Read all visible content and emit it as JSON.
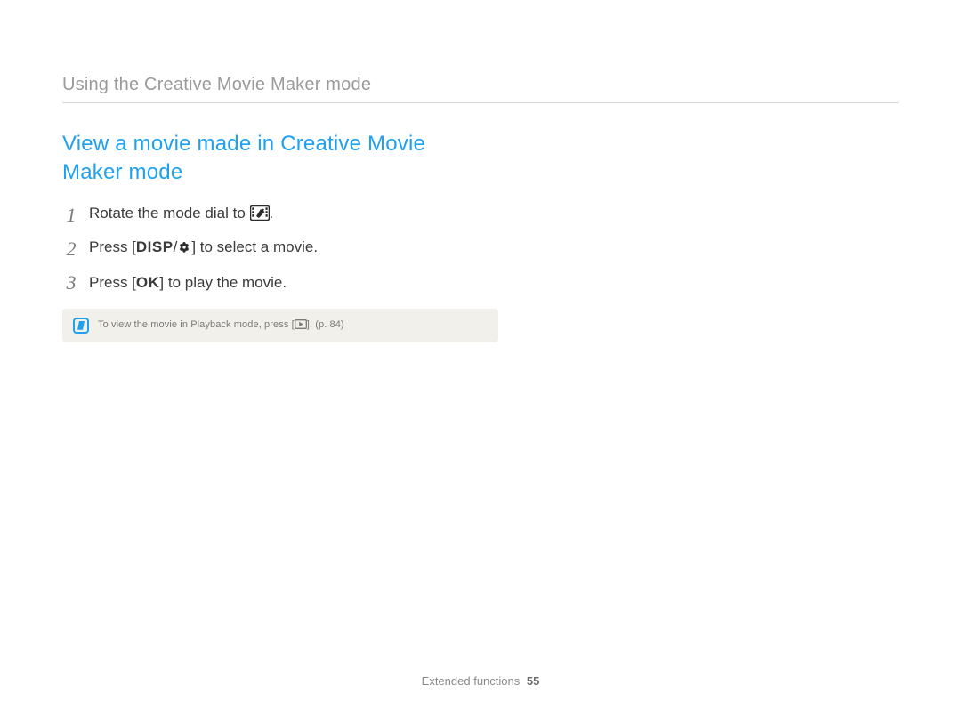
{
  "header": {
    "title": "Using the Creative Movie Maker mode"
  },
  "section": {
    "heading": "View a movie made in Creative Movie Maker mode"
  },
  "steps": [
    {
      "num": "1",
      "before": "Rotate the mode dial to ",
      "icon": "film-edit-icon",
      "after": "."
    },
    {
      "num": "2",
      "before": "Press [",
      "icon_label": "DISP",
      "mid": "/",
      "icon2": "macro-flower-icon",
      "after": "] to select a movie."
    },
    {
      "num": "3",
      "before": "Press [",
      "icon_label": "OK",
      "after": "] to play the movie."
    }
  ],
  "note": {
    "before": "To view the movie in Playback mode, press [",
    "icon": "playback-icon",
    "after": "]. (p. 84)"
  },
  "footer": {
    "section": "Extended functions",
    "page": "55"
  }
}
